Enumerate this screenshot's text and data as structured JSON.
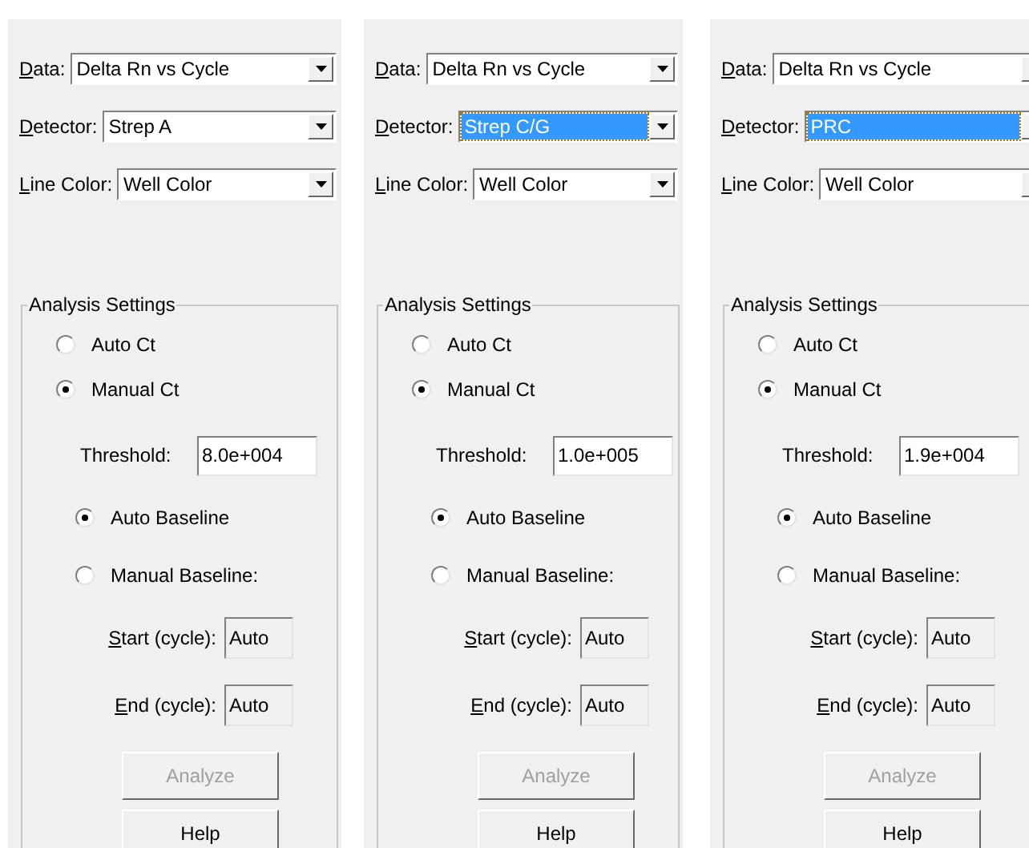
{
  "panels": [
    {
      "fields": [
        {
          "label": "Data:",
          "value": "Delta Rn vs Cycle",
          "highlighted": false
        },
        {
          "label": "Detector:",
          "value": "Strep A",
          "highlighted": false
        },
        {
          "label": "Line Color:",
          "value": "Well Color",
          "highlighted": false
        }
      ],
      "group": {
        "title": "Analysis Settings",
        "ct_modes": [
          {
            "label": "Auto Ct",
            "selected": false
          },
          {
            "label": "Manual Ct",
            "selected": true
          }
        ],
        "threshold": {
          "label": "Threshold:",
          "value": "8.0e+004"
        },
        "baselines": [
          {
            "label": "Auto Baseline",
            "selected": true
          },
          {
            "label": "Manual Baseline:",
            "selected": false
          }
        ],
        "cycles": [
          {
            "label": "Start (cycle):",
            "value": "Auto"
          },
          {
            "label": "End (cycle):",
            "value": "Auto"
          }
        ],
        "buttons": [
          {
            "label": "Analyze",
            "disabled": true
          },
          {
            "label": "Help",
            "disabled": false
          }
        ]
      }
    },
    {
      "fields": [
        {
          "label": "Data:",
          "value": "Delta Rn vs Cycle",
          "highlighted": false
        },
        {
          "label": "Detector:",
          "value": "Strep C/G",
          "highlighted": true
        },
        {
          "label": "Line Color:",
          "value": "Well Color",
          "highlighted": false
        }
      ],
      "group": {
        "title": "Analysis Settings",
        "ct_modes": [
          {
            "label": "Auto Ct",
            "selected": false
          },
          {
            "label": "Manual Ct",
            "selected": true
          }
        ],
        "threshold": {
          "label": "Threshold:",
          "value": "1.0e+005"
        },
        "baselines": [
          {
            "label": "Auto Baseline",
            "selected": true
          },
          {
            "label": "Manual Baseline:",
            "selected": false
          }
        ],
        "cycles": [
          {
            "label": "Start (cycle):",
            "value": "Auto"
          },
          {
            "label": "End (cycle):",
            "value": "Auto"
          }
        ],
        "buttons": [
          {
            "label": "Analyze",
            "disabled": true
          },
          {
            "label": "Help",
            "disabled": false
          }
        ]
      }
    },
    {
      "fields": [
        {
          "label": "Data:",
          "value": "Delta Rn vs Cycle",
          "highlighted": false
        },
        {
          "label": "Detector:",
          "value": "PRC",
          "highlighted": true
        },
        {
          "label": "Line Color:",
          "value": "Well Color",
          "highlighted": false
        }
      ],
      "group": {
        "title": "Analysis Settings",
        "ct_modes": [
          {
            "label": "Auto Ct",
            "selected": false
          },
          {
            "label": "Manual Ct",
            "selected": true
          }
        ],
        "threshold": {
          "label": "Threshold:",
          "value": "1.9e+004"
        },
        "baselines": [
          {
            "label": "Auto Baseline",
            "selected": true
          },
          {
            "label": "Manual Baseline:",
            "selected": false
          }
        ],
        "cycles": [
          {
            "label": "Start (cycle):",
            "value": "Auto"
          },
          {
            "label": "End (cycle):",
            "value": "Auto"
          }
        ],
        "buttons": [
          {
            "label": "Analyze",
            "disabled": true
          },
          {
            "label": "Help",
            "disabled": false
          }
        ]
      }
    }
  ]
}
